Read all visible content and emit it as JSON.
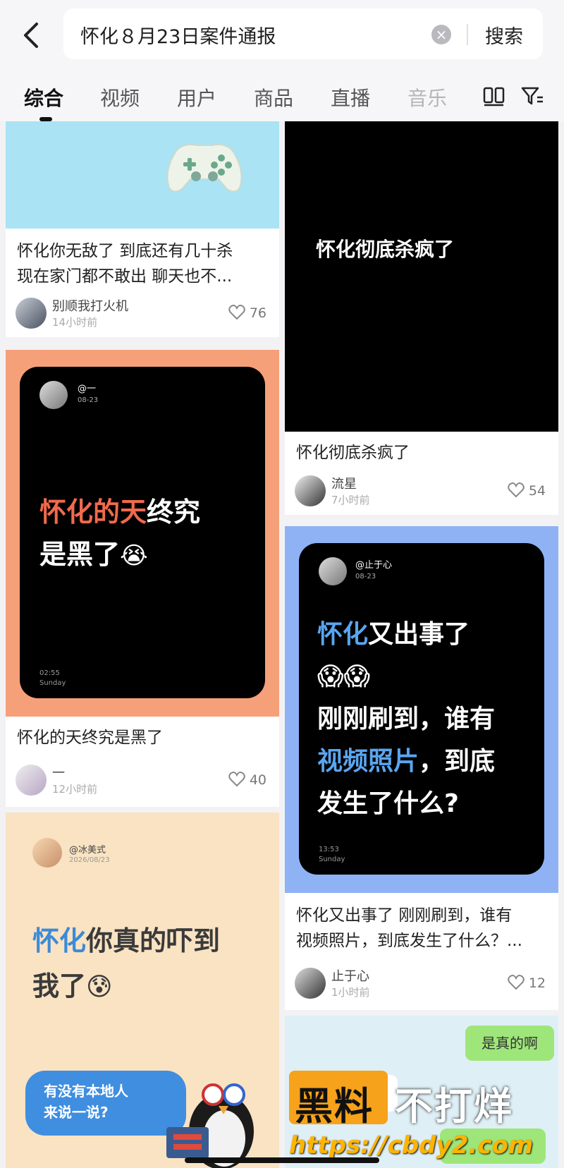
{
  "search": {
    "query": "怀化８月23日案件通报",
    "clear_symbol": "×",
    "button": "搜索"
  },
  "tabs": [
    "综合",
    "视频",
    "用户",
    "商品",
    "直播",
    "音乐"
  ],
  "active_tab": "综合",
  "cards": {
    "c1": {
      "title_line1": "怀化你无敌了 到底还有几十杀",
      "title_line2": "现在家门都不敢出 聊天也不...",
      "user": "别顺我打火机",
      "time": "14小时前",
      "likes": "76",
      "image_bg": "#a9e3f4"
    },
    "c2": {
      "overlay": "怀化彻底杀疯了",
      "title": "怀化彻底杀疯了",
      "user": "流星",
      "time": "7小时前",
      "likes": "54"
    },
    "c3": {
      "handle": "@一",
      "date": "08-23",
      "line1_red": "怀化的天",
      "line1_white": "终究",
      "line2": "是黑了",
      "emoji": "😭",
      "clock": "02:55",
      "day": "Sunday",
      "title": "怀化的天终究是黑了",
      "user": "一",
      "time": "12小时前",
      "likes": "40",
      "image_bg": "#f6a07a"
    },
    "c4": {
      "handle": "@止于心",
      "date": "08-23",
      "l1_blue": "怀化",
      "l1_white": "又出事了",
      "emoji": "😱😱",
      "l3": "刚刚刷到，谁有",
      "l4_blue": "视频照片",
      "l4_white": "，到底",
      "l5": "发生了什么?",
      "clock": "13:53",
      "day": "Sunday",
      "title_line1": "怀化又出事了 刚刚刷到，谁有",
      "title_line2": "视频照片，到底发生了什么？...",
      "user": "止于心",
      "time": "1小时前",
      "likes": "12",
      "image_bg": "#8fb2f5"
    },
    "c5": {
      "handle": "@冰美式",
      "date": "2026/08/23",
      "l1_blue": "怀化",
      "l1_dark": "你真的吓到",
      "l2": "我了",
      "emoji": "😰",
      "bubble_line1": "有没有本地人",
      "bubble_line2": "来说一说?",
      "image_bg": "#f9e3c3"
    },
    "c6": {
      "chat_bubble": "是真的啊"
    }
  },
  "watermark": {
    "part1": "黑料",
    "part2": "不打烊",
    "url": "https://cbdy2.com"
  }
}
